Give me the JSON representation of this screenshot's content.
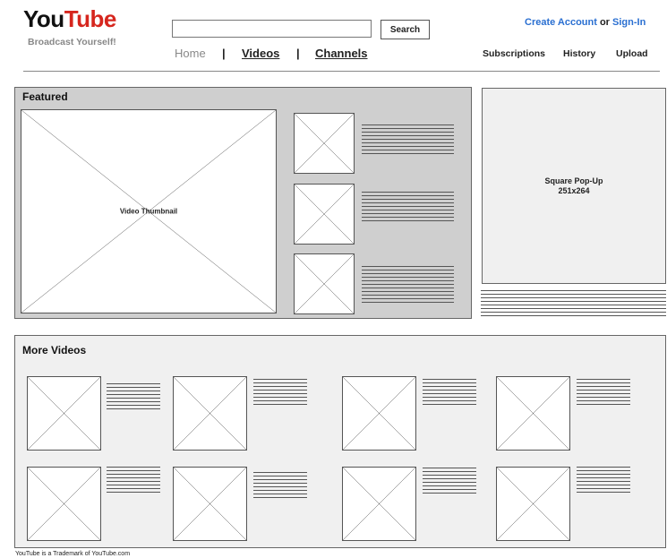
{
  "header": {
    "logo": {
      "part1": "You",
      "part2": "Tube"
    },
    "tagline": "Broadcast Yourself!",
    "search": {
      "placeholder": "",
      "button_label": "Search"
    },
    "nav": {
      "home": "Home",
      "separator": "|",
      "videos": "Videos",
      "channels": "Channels"
    },
    "account": {
      "create": "Create Account",
      "or": " or ",
      "signin": "Sign-In"
    },
    "utility": {
      "subscriptions": "Subscriptions",
      "history": "History",
      "upload": "Upload"
    }
  },
  "featured": {
    "title": "Featured",
    "main_thumbnail_label": "Video Thumbnail"
  },
  "ad": {
    "label_line1": "Square Pop-Up",
    "label_line2": "251x264"
  },
  "more_videos": {
    "title": "More Videos"
  },
  "footer": {
    "text": "YouTube is a Trademark of YouTube.com"
  },
  "colors": {
    "brand_red": "#d6261e",
    "link_blue": "#2a6fd1",
    "featured_bg": "#cfcfcf",
    "more_bg": "#f0f0f0"
  }
}
